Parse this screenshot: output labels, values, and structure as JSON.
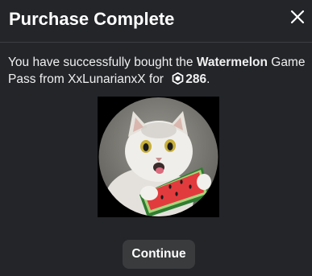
{
  "dialog": {
    "title": "Purchase Complete",
    "message": {
      "prefix": "You have successfully bought the ",
      "item_name": "Watermelon",
      "middle": " Game Pass from XxLunarianxX for ",
      "price": "286",
      "suffix": "."
    },
    "continue_label": "Continue"
  },
  "icons": {
    "close": "close-icon",
    "currency": "robux-icon",
    "thumbnail": "cat-with-watermelon-thumbnail"
  },
  "colors": {
    "background": "#232529",
    "divider": "#3b3e44",
    "button": "#393b3d",
    "text": "#ffffff"
  }
}
